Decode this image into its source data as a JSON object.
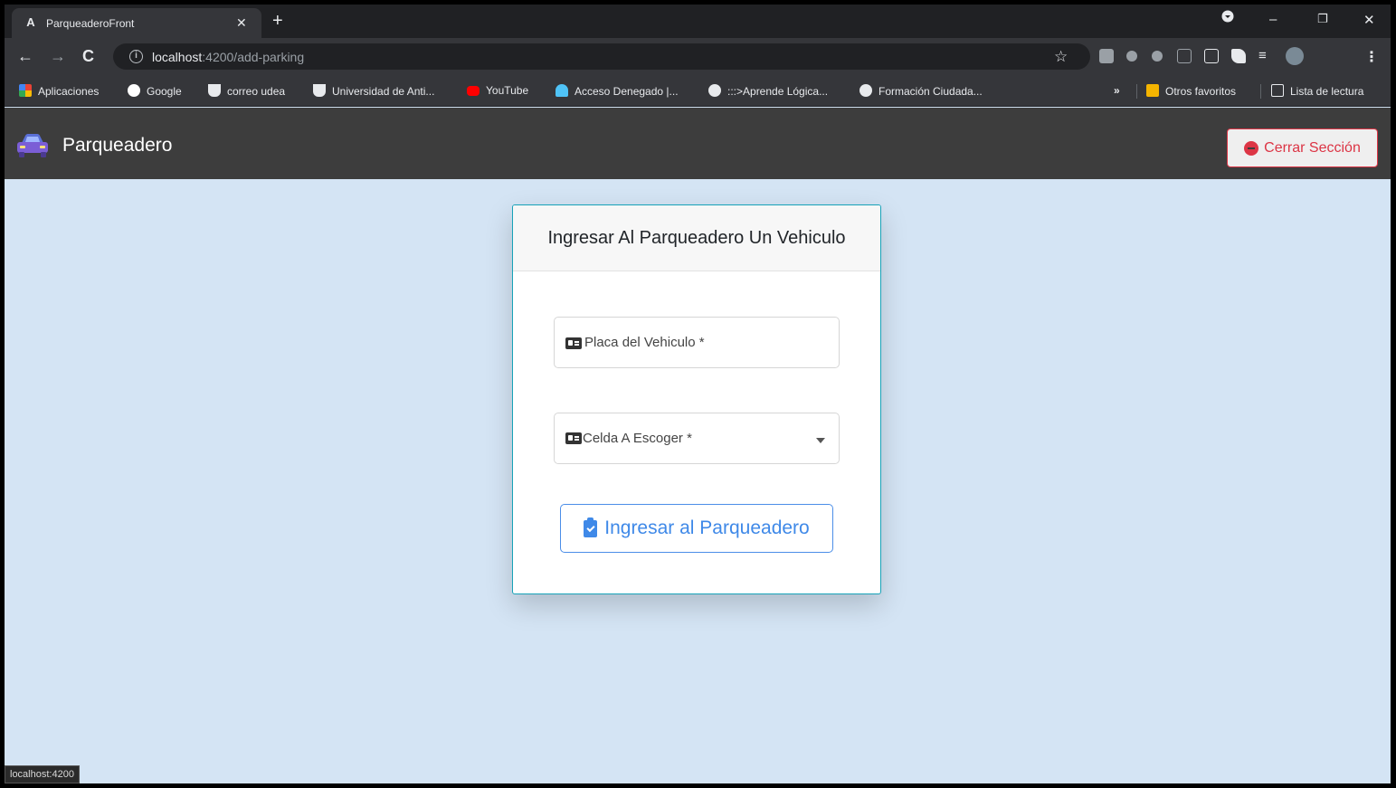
{
  "browser": {
    "tab": {
      "title": "ParqueaderoFront",
      "favicon": "A"
    },
    "address": {
      "host": "localhost",
      "path": ":4200/add-parking"
    },
    "bookmarks": [
      {
        "label": "Aplicaciones",
        "icon": "apps-grid-icon",
        "color": "#f4b400"
      },
      {
        "label": "Google",
        "icon": "google-icon",
        "color": "#ffffff"
      },
      {
        "label": "correo udea",
        "icon": "udea-icon",
        "color": "#e8eaed"
      },
      {
        "label": "Universidad de Anti...",
        "icon": "udea-icon",
        "color": "#e8eaed"
      },
      {
        "label": "YouTube",
        "icon": "youtube-icon",
        "color": "#ff0000"
      },
      {
        "label": "Acceso Denegado |...",
        "icon": "access-icon",
        "color": "#4fc3f7"
      },
      {
        "label": ":::>Aprende Lógica...",
        "icon": "globe-icon",
        "color": "#e8eaed"
      },
      {
        "label": "Formación Ciudada...",
        "icon": "globe-icon",
        "color": "#e8eaed"
      },
      {
        "label": "»",
        "icon": "",
        "color": ""
      },
      {
        "label": "Otros favoritos",
        "icon": "folder-icon",
        "color": "#f4b400"
      },
      {
        "label": "Lista de lectura",
        "icon": "reading-list-icon",
        "color": "#e8eaed"
      }
    ],
    "status_url": "localhost:4200"
  },
  "navbar": {
    "brand": "Parqueadero",
    "logout_label": "Cerrar Sección",
    "accent_danger": "#dc3545"
  },
  "form": {
    "title": "Ingresar Al Parqueadero Un Vehiculo",
    "plate_placeholder": "Placa del Vehiculo *",
    "cell_placeholder": "Celda A Escoger *",
    "submit_label": "Ingresar al Parqueadero",
    "accent_primary": "#3f89e8"
  }
}
